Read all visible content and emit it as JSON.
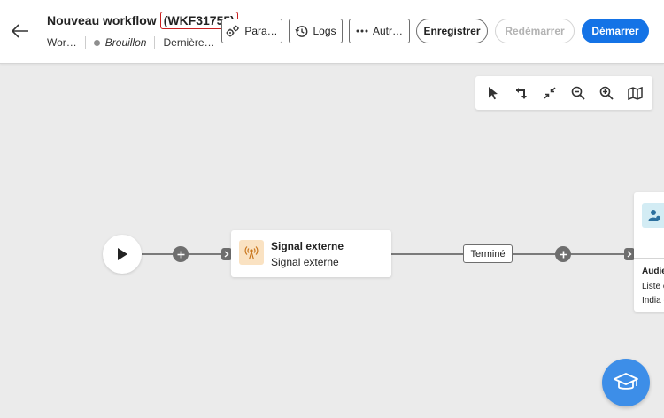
{
  "header": {
    "back_icon": "arrow-left-icon",
    "title": "Nouveau workflow",
    "id_badge": "(WKF31755)",
    "meta": {
      "type": "Wor…",
      "status": "Brouillon",
      "last_modified": "Dernière…"
    },
    "buttons": {
      "params": "Para…",
      "logs": "Logs",
      "more": "Autr…",
      "save": "Enregistrer",
      "restart": "Redémarrer",
      "start": "Démarrer"
    }
  },
  "toolbar": {
    "tools": [
      "select-arrow-icon",
      "rotate-layout-icon",
      "collapse-icon",
      "zoom-out-icon",
      "zoom-in-icon",
      "map-icon"
    ]
  },
  "workflow": {
    "node1": {
      "title": "Signal externe",
      "subtitle": "Signal externe",
      "icon": "broadcast-icon"
    },
    "transition_label": "Terminé",
    "node2": {
      "icon": "audience-icon",
      "line1": "Audie",
      "line2": "Liste c",
      "line3": "India c"
    }
  },
  "colors": {
    "primary": "#1473e6",
    "highlight": "#c91f1f",
    "help": "#3d8ee8"
  }
}
